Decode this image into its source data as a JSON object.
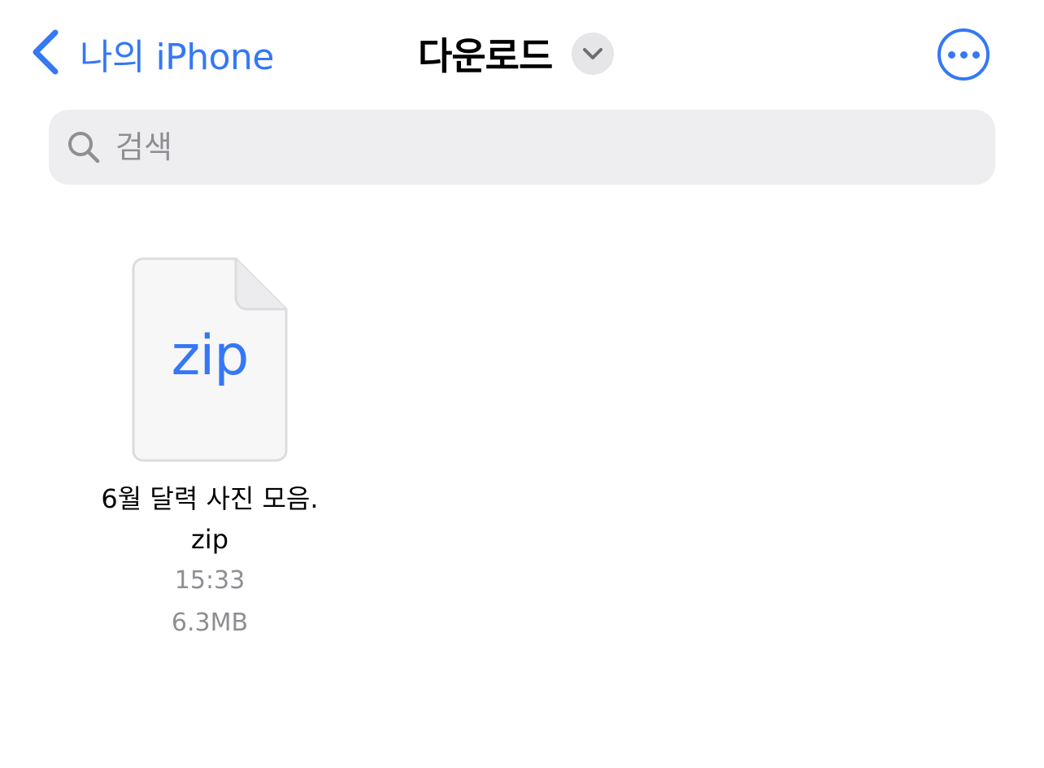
{
  "nav": {
    "back_label": "나의 iPhone",
    "title": "다운로드",
    "chevron_icon": "chevron-down-icon",
    "more_icon": "ellipsis-circle-icon"
  },
  "search": {
    "placeholder": "검색",
    "value": "",
    "icon": "magnifying-glass-icon"
  },
  "files": [
    {
      "extension": "zip",
      "name": "6월 달력 사진 모음.zip",
      "time": "15:33",
      "size": "6.3MB",
      "icon": "zip-document-icon"
    }
  ],
  "colors": {
    "accent": "#3478f6",
    "secondary_text": "#8e8e93",
    "search_background": "#eeeef0"
  }
}
